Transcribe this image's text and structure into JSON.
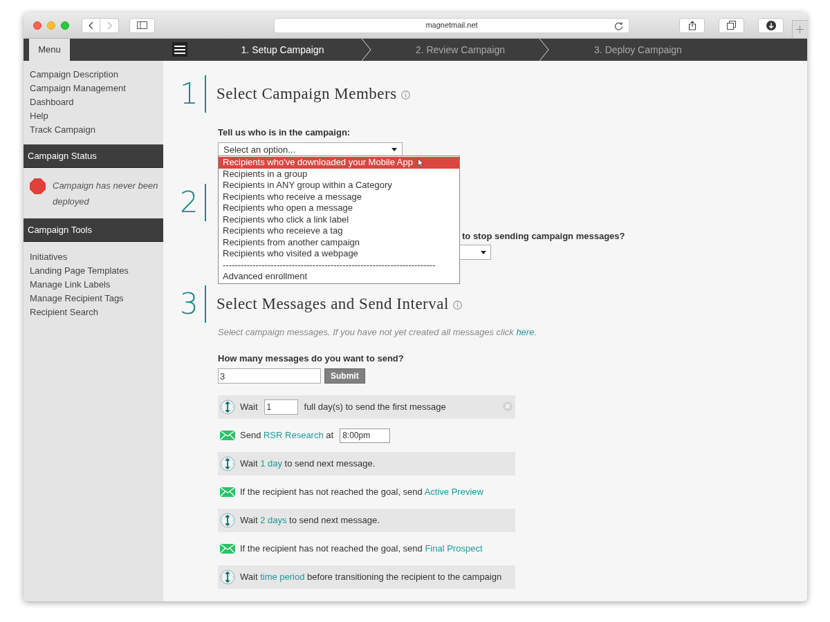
{
  "browser": {
    "url": "magnetmail.net"
  },
  "menu_tab": "Menu",
  "steps": [
    {
      "label": "1. Setup Campaign",
      "selected": true
    },
    {
      "label": "2. Review Campaign",
      "selected": false
    },
    {
      "label": "3. Deploy Campaign",
      "selected": false
    }
  ],
  "sidebar": {
    "links": [
      "Campaign Description",
      "Campaign Management",
      "Dashboard",
      "Help",
      "Track Campaign"
    ],
    "status": {
      "title": "Campaign Status",
      "text": "Campaign has never been deployed",
      "color": "#e0403a"
    },
    "tools": {
      "title": "Campaign Tools",
      "links": [
        "Initiatives",
        "Landing Page Templates",
        "Manage Link Labels",
        "Manage Recipient Tags",
        "Recipient Search"
      ]
    }
  },
  "section_1": {
    "number": "1",
    "title": "Select Campaign Members",
    "label": "Tell us who is in the campaign:",
    "select": {
      "value": "Select an option...",
      "expanded": true,
      "options": [
        {
          "label": "Recipients who've downloaded your Mobile App",
          "selected": true
        },
        {
          "label": "Recipients in a group",
          "selected": false
        },
        {
          "label": "Recipients in ANY group within a Category",
          "selected": false
        },
        {
          "label": "Recipients who receive a message",
          "selected": false
        },
        {
          "label": "Recipients who open a message",
          "selected": false
        },
        {
          "label": "Recipients who click a link label",
          "selected": false
        },
        {
          "label": "Recipients who receieve a tag",
          "selected": false
        },
        {
          "label": "Recipients from another campaign",
          "selected": false
        },
        {
          "label": "Recipients who visited a webpage",
          "selected": false
        },
        {
          "label": "-----------------------------------------------------------------------",
          "selected": false
        },
        {
          "label": "Advanced enrollment",
          "selected": false
        }
      ]
    }
  },
  "section_2": {
    "number": "2",
    "label": "to stop sending campaign messages?"
  },
  "section_3": {
    "number": "3",
    "title": "Select Messages and Send Interval",
    "hint": "Select campaign messages. If you have not yet created all messages click ",
    "hint_link": "here",
    "hint_end": ".",
    "count_label": "How many messages do you want to send?",
    "count_value": "3",
    "submit": "Submit",
    "rows": [
      {
        "kind": "wait_input",
        "pre": "Wait",
        "value": "1",
        "post": "full day(s) to send the first message",
        "removable": true
      },
      {
        "kind": "send",
        "pre": "Send",
        "link": "RSR Research",
        "post": "at",
        "time": "8:00pm"
      },
      {
        "kind": "wait",
        "pre": "Wait",
        "link": "1 day",
        "post": "to send next message."
      },
      {
        "kind": "send",
        "pre": "If the recipient has not reached the goal, send",
        "link": "Active Preview"
      },
      {
        "kind": "wait",
        "pre": "Wait",
        "link": "2 days",
        "post": "to send next message."
      },
      {
        "kind": "send",
        "pre": "If the recipient has not reached the goal, send",
        "link": "Final Prospect"
      },
      {
        "kind": "wait",
        "pre": "Wait",
        "link": "time period",
        "post": "before transitioning the recipient to the campaign"
      }
    ]
  }
}
